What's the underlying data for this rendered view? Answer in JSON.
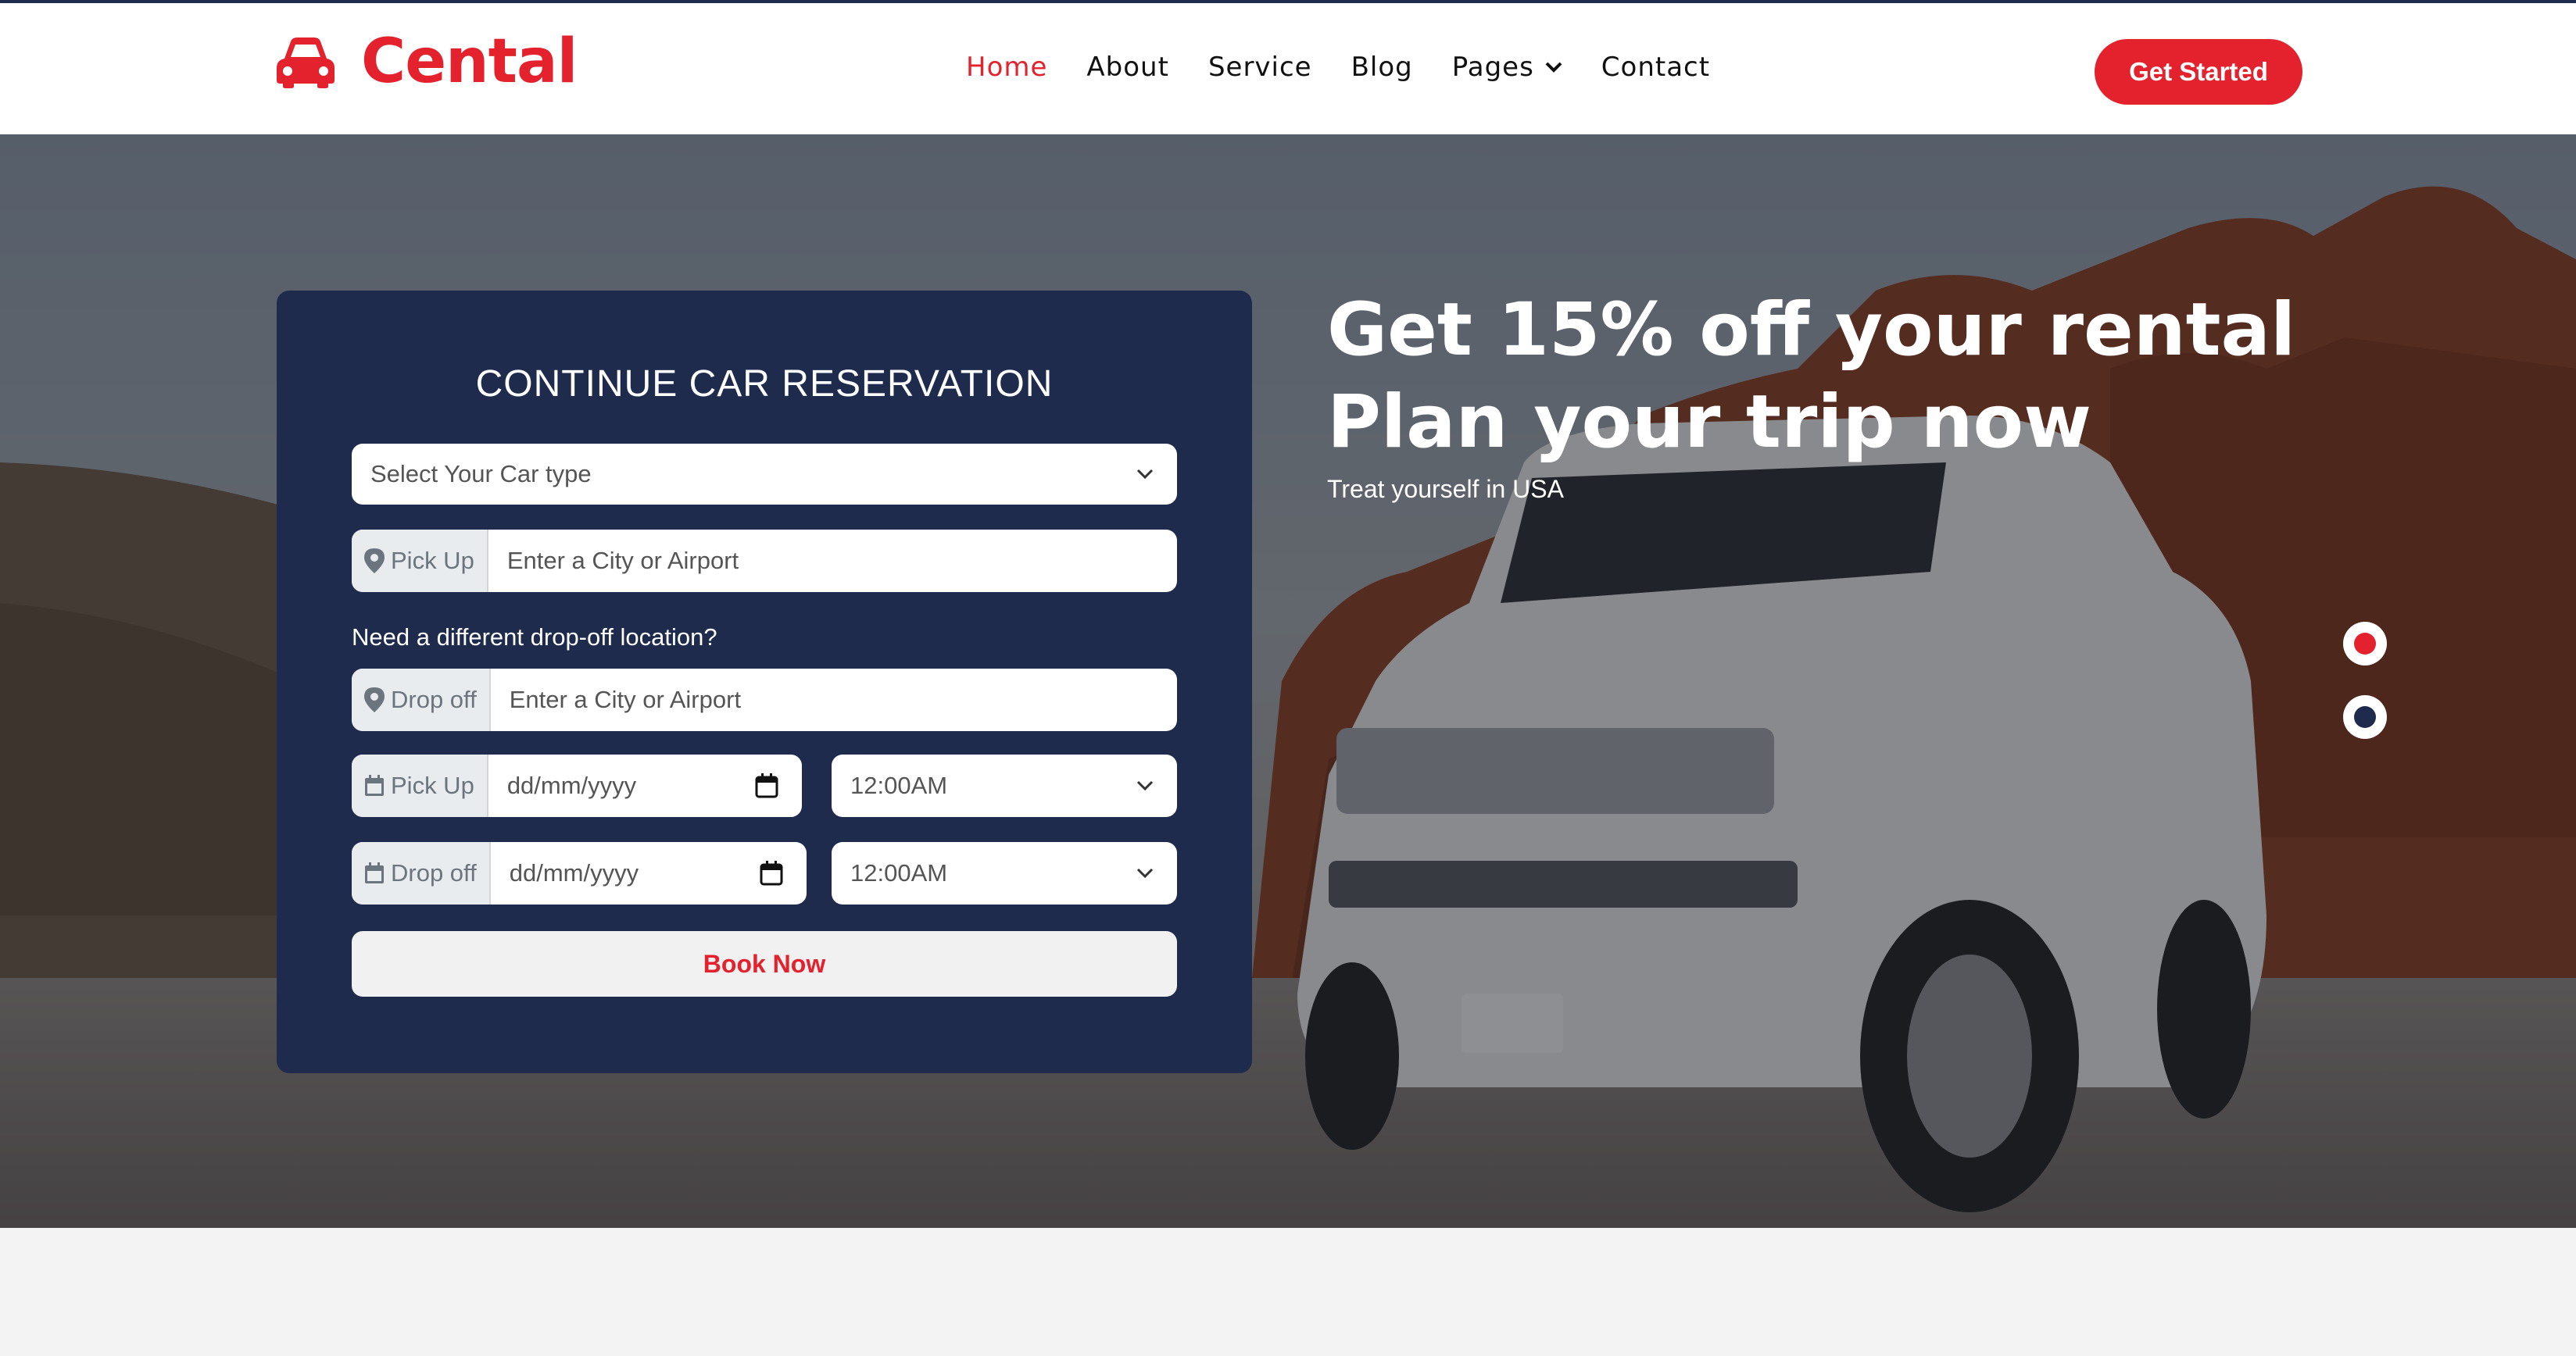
{
  "brand": {
    "name": "Cental",
    "accent": "#e3222d",
    "navy": "#1e2b4c"
  },
  "nav": {
    "items": [
      {
        "label": "Home",
        "active": true
      },
      {
        "label": "About"
      },
      {
        "label": "Service"
      },
      {
        "label": "Blog"
      },
      {
        "label": "Pages",
        "has_dropdown": true
      },
      {
        "label": "Contact"
      }
    ],
    "cta_label": "Get Started"
  },
  "reservation": {
    "title": "CONTINUE CAR RESERVATION",
    "car_type": {
      "value": "Select Your Car type",
      "icon": "chevron-down-icon"
    },
    "pickup_location": {
      "prefix": "Pick Up",
      "placeholder": "Enter a City or Airport",
      "icon": "map-marker-icon"
    },
    "dropoff_note": "Need a different drop-off location?",
    "dropoff_location": {
      "prefix": "Drop off",
      "placeholder": "Enter a City or Airport",
      "icon": "map-marker-icon"
    },
    "pickup_datetime": {
      "prefix": "Pick Up",
      "date_placeholder": "dd/mm/yyyy",
      "time": "12:00AM",
      "icon": "calendar-icon"
    },
    "dropoff_datetime": {
      "prefix": "Drop off",
      "date_placeholder": "dd/mm/yyyy",
      "time": "12:00AM",
      "icon": "calendar-icon"
    },
    "submit_label": "Book Now"
  },
  "hero": {
    "headline_line1": "Get 15% off your rental",
    "headline_line2": "Plan your trip now",
    "subtext": "Treat yourself in USA",
    "carousel": {
      "slides": 2,
      "active_index": 0
    }
  }
}
